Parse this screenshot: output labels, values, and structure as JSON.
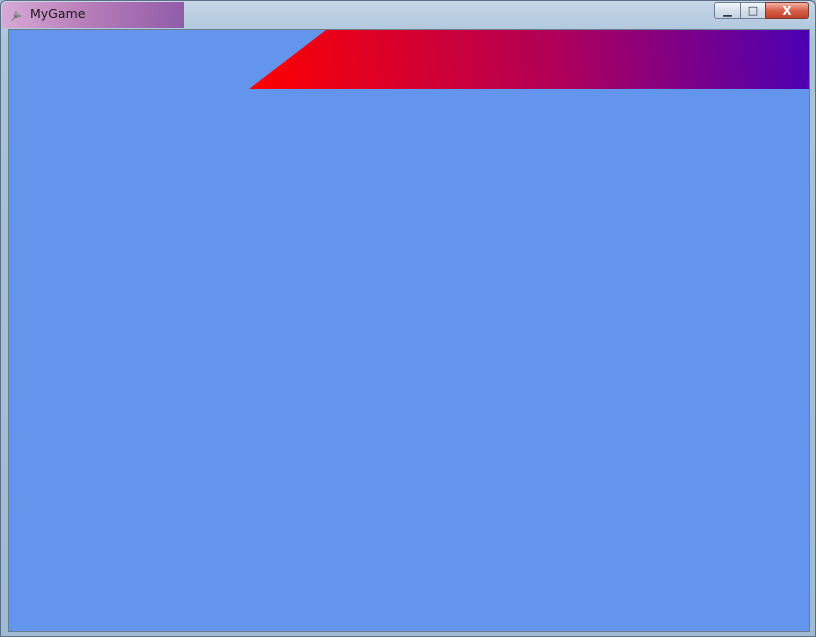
{
  "window": {
    "title": "MyGame",
    "caption_buttons": {
      "minimize_glyph": "▁",
      "maximize_glyph": "□",
      "close_glyph": "X"
    }
  },
  "game": {
    "clear_color": "#6495ED",
    "banner_gradient": {
      "start_color": "#FF0000",
      "mid_color": "#B0005A",
      "end_color": "#4B00B4"
    }
  },
  "icons": {
    "app_icon": "game-app-icon"
  }
}
